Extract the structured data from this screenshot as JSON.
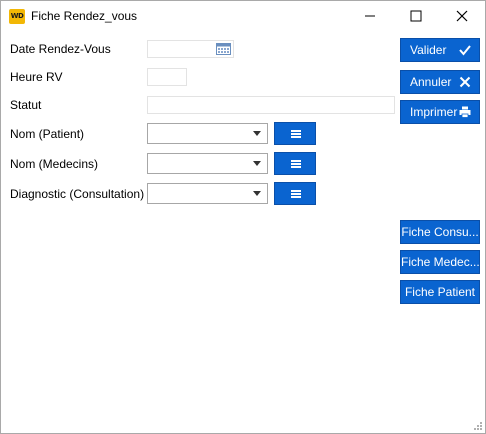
{
  "window": {
    "title": "Fiche Rendez_vous",
    "app_icon_text": "WD"
  },
  "form": {
    "date_label": "Date Rendez-Vous",
    "heure_label": "Heure RV",
    "statut_label": "Statut",
    "patient_label": "Nom (Patient)",
    "medecins_label": "Nom (Medecins)",
    "diagnostic_label": "Diagnostic (Consultation)"
  },
  "actions": {
    "valider": "Valider",
    "annuler": "Annuler",
    "imprimer": "Imprimer",
    "fiche_consultation": "Fiche Consu...",
    "fiche_medecin": "Fiche Medec...",
    "fiche_patient": "Fiche Patient"
  },
  "colors": {
    "button_blue": "#0a64d0",
    "app_icon": "#f2b705"
  },
  "icons": [
    "calendar-icon",
    "check-icon",
    "close-icon",
    "printer-icon",
    "list-icon",
    "chevron-down-icon",
    "minimize-icon",
    "maximize-icon",
    "resize-grip-icon"
  ]
}
